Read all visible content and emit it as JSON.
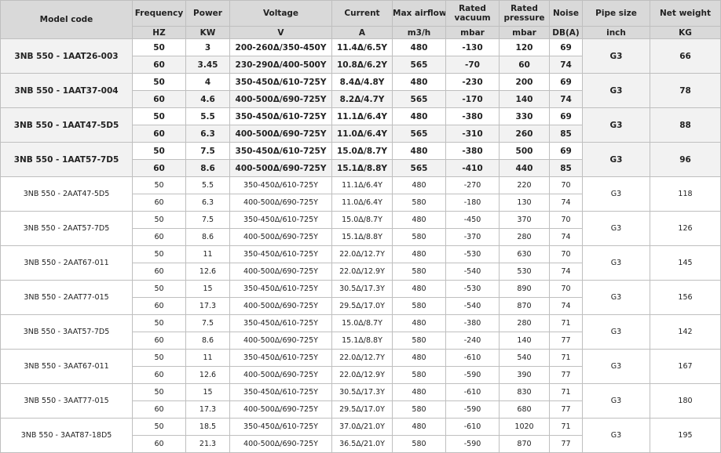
{
  "table": {
    "headers": [
      {
        "label": "Model code",
        "unit": ""
      },
      {
        "label": "Frequency",
        "unit": "HZ"
      },
      {
        "label": "Power",
        "unit": "KW"
      },
      {
        "label": "Voltage",
        "unit": "V"
      },
      {
        "label": "Current",
        "unit": "A"
      },
      {
        "label": "Max airflow",
        "unit": "m3/h"
      },
      {
        "label": "Rated vacuum",
        "unit": "mbar"
      },
      {
        "label": "Rated pressure",
        "unit": "mbar"
      },
      {
        "label": "Noise",
        "unit": "DB(A)"
      },
      {
        "label": "Pipe size",
        "unit": "inch"
      },
      {
        "label": "Net weight",
        "unit": "KG"
      }
    ],
    "groups": [
      {
        "model": "3NB 550 - 1AAT26-003",
        "pipe": "G3",
        "weight": "66",
        "style": "bold",
        "rows": [
          {
            "freq": "50",
            "power": "3",
            "voltage": "200-260Δ/350-450Y",
            "current": "11.4Δ/6.5Y",
            "airflow": "480",
            "vacuum": "-130",
            "pressure": "120",
            "noise": "69"
          },
          {
            "freq": "60",
            "power": "3.45",
            "voltage": "230-290Δ/400-500Y",
            "current": "10.8Δ/6.2Y",
            "airflow": "565",
            "vacuum": "-70",
            "pressure": "60",
            "noise": "74"
          }
        ]
      },
      {
        "model": "3NB 550 - 1AAT37-004",
        "pipe": "G3",
        "weight": "78",
        "style": "bold",
        "rows": [
          {
            "freq": "50",
            "power": "4",
            "voltage": "350-450Δ/610-725Y",
            "current": "8.4Δ/4.8Y",
            "airflow": "480",
            "vacuum": "-230",
            "pressure": "200",
            "noise": "69"
          },
          {
            "freq": "60",
            "power": "4.6",
            "voltage": "400-500Δ/690-725Y",
            "current": "8.2Δ/4.7Y",
            "airflow": "565",
            "vacuum": "-170",
            "pressure": "140",
            "noise": "74"
          }
        ]
      },
      {
        "model": "3NB 550 - 1AAT47-5D5",
        "pipe": "G3",
        "weight": "88",
        "style": "bold",
        "rows": [
          {
            "freq": "50",
            "power": "5.5",
            "voltage": "350-450Δ/610-725Y",
            "current": "11.1Δ/6.4Y",
            "airflow": "480",
            "vacuum": "-380",
            "pressure": "330",
            "noise": "69"
          },
          {
            "freq": "60",
            "power": "6.3",
            "voltage": "400-500Δ/690-725Y",
            "current": "11.0Δ/6.4Y",
            "airflow": "565",
            "vacuum": "-310",
            "pressure": "260",
            "noise": "85"
          }
        ]
      },
      {
        "model": "3NB 550 - 1AAT57-7D5",
        "pipe": "G3",
        "weight": "96",
        "style": "bold",
        "rows": [
          {
            "freq": "50",
            "power": "7.5",
            "voltage": "350-450Δ/610-725Y",
            "current": "15.0Δ/8.7Y",
            "airflow": "480",
            "vacuum": "-380",
            "pressure": "500",
            "noise": "69"
          },
          {
            "freq": "60",
            "power": "8.6",
            "voltage": "400-500Δ/690-725Y",
            "current": "15.1Δ/8.8Y",
            "airflow": "565",
            "vacuum": "-410",
            "pressure": "440",
            "noise": "85"
          }
        ]
      },
      {
        "model": "3NB 550 - 2AAT47-5D5",
        "pipe": "G3",
        "weight": "118",
        "style": "plain",
        "rows": [
          {
            "freq": "50",
            "power": "5.5",
            "voltage": "350-450Δ/610-725Y",
            "current": "11.1Δ/6.4Y",
            "airflow": "480",
            "vacuum": "-270",
            "pressure": "220",
            "noise": "70"
          },
          {
            "freq": "60",
            "power": "6.3",
            "voltage": "400-500Δ/690-725Y",
            "current": "11.0Δ/6.4Y",
            "airflow": "580",
            "vacuum": "-180",
            "pressure": "130",
            "noise": "74"
          }
        ]
      },
      {
        "model": "3NB 550 - 2AAT57-7D5",
        "pipe": "G3",
        "weight": "126",
        "style": "plain",
        "rows": [
          {
            "freq": "50",
            "power": "7.5",
            "voltage": "350-450Δ/610-725Y",
            "current": "15.0Δ/8.7Y",
            "airflow": "480",
            "vacuum": "-450",
            "pressure": "370",
            "noise": "70"
          },
          {
            "freq": "60",
            "power": "8.6",
            "voltage": "400-500Δ/690-725Y",
            "current": "15.1Δ/8.8Y",
            "airflow": "580",
            "vacuum": "-370",
            "pressure": "280",
            "noise": "74"
          }
        ]
      },
      {
        "model": "3NB 550 - 2AAT67-011",
        "pipe": "G3",
        "weight": "145",
        "style": "plain",
        "rows": [
          {
            "freq": "50",
            "power": "11",
            "voltage": "350-450Δ/610-725Y",
            "current": "22.0Δ/12.7Y",
            "airflow": "480",
            "vacuum": "-530",
            "pressure": "630",
            "noise": "70"
          },
          {
            "freq": "60",
            "power": "12.6",
            "voltage": "400-500Δ/690-725Y",
            "current": "22.0Δ/12.9Y",
            "airflow": "580",
            "vacuum": "-540",
            "pressure": "530",
            "noise": "74"
          }
        ]
      },
      {
        "model": "3NB 550 - 2AAT77-015",
        "pipe": "G3",
        "weight": "156",
        "style": "plain",
        "rows": [
          {
            "freq": "50",
            "power": "15",
            "voltage": "350-450Δ/610-725Y",
            "current": "30.5Δ/17.3Y",
            "airflow": "480",
            "vacuum": "-530",
            "pressure": "890",
            "noise": "70"
          },
          {
            "freq": "60",
            "power": "17.3",
            "voltage": "400-500Δ/690-725Y",
            "current": "29.5Δ/17.0Y",
            "airflow": "580",
            "vacuum": "-540",
            "pressure": "870",
            "noise": "74"
          }
        ]
      },
      {
        "model": "3NB 550 - 3AAT57-7D5",
        "pipe": "G3",
        "weight": "142",
        "style": "plain",
        "rows": [
          {
            "freq": "50",
            "power": "7.5",
            "voltage": "350-450Δ/610-725Y",
            "current": "15.0Δ/8.7Y",
            "airflow": "480",
            "vacuum": "-380",
            "pressure": "280",
            "noise": "71"
          },
          {
            "freq": "60",
            "power": "8.6",
            "voltage": "400-500Δ/690-725Y",
            "current": "15.1Δ/8.8Y",
            "airflow": "580",
            "vacuum": "-240",
            "pressure": "140",
            "noise": "77"
          }
        ]
      },
      {
        "model": "3NB 550 - 3AAT67-011",
        "pipe": "G3",
        "weight": "167",
        "style": "plain",
        "rows": [
          {
            "freq": "50",
            "power": "11",
            "voltage": "350-450Δ/610-725Y",
            "current": "22.0Δ/12.7Y",
            "airflow": "480",
            "vacuum": "-610",
            "pressure": "540",
            "noise": "71"
          },
          {
            "freq": "60",
            "power": "12.6",
            "voltage": "400-500Δ/690-725Y",
            "current": "22.0Δ/12.9Y",
            "airflow": "580",
            "vacuum": "-590",
            "pressure": "390",
            "noise": "77"
          }
        ]
      },
      {
        "model": "3NB 550 - 3AAT77-015",
        "pipe": "G3",
        "weight": "180",
        "style": "plain",
        "rows": [
          {
            "freq": "50",
            "power": "15",
            "voltage": "350-450Δ/610-725Y",
            "current": "30.5Δ/17.3Y",
            "airflow": "480",
            "vacuum": "-610",
            "pressure": "830",
            "noise": "71"
          },
          {
            "freq": "60",
            "power": "17.3",
            "voltage": "400-500Δ/690-725Y",
            "current": "29.5Δ/17.0Y",
            "airflow": "580",
            "vacuum": "-590",
            "pressure": "680",
            "noise": "77"
          }
        ]
      },
      {
        "model": "3NB 550 - 3AAT87-18D5",
        "pipe": "G3",
        "weight": "195",
        "style": "plain",
        "rows": [
          {
            "freq": "50",
            "power": "18.5",
            "voltage": "350-450Δ/610-725Y",
            "current": "37.0Δ/21.0Y",
            "airflow": "480",
            "vacuum": "-610",
            "pressure": "1020",
            "noise": "71"
          },
          {
            "freq": "60",
            "power": "21.3",
            "voltage": "400-500Δ/690-725Y",
            "current": "36.5Δ/21.0Y",
            "airflow": "580",
            "vacuum": "-590",
            "pressure": "870",
            "noise": "77"
          }
        ]
      }
    ]
  }
}
